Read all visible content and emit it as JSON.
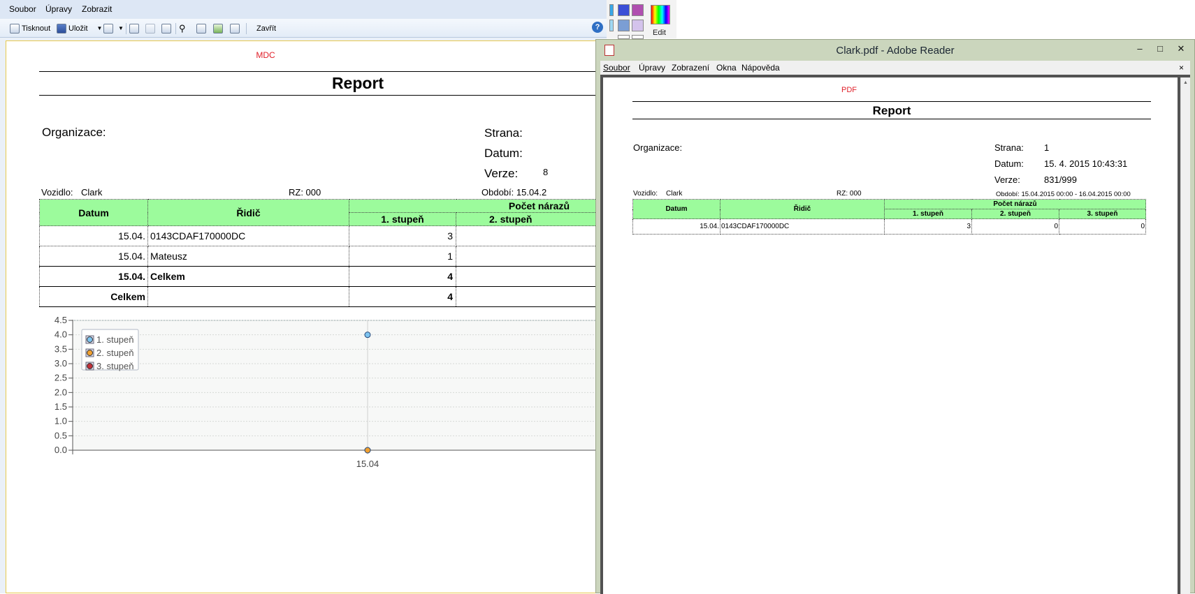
{
  "viewer": {
    "menu": [
      "Soubor",
      "Úpravy",
      "Zobrazit"
    ],
    "toolbar": {
      "print_label": "Tisknout",
      "save_label": "Uložit",
      "close_label": "Zavřít"
    },
    "help_label": "?"
  },
  "report": {
    "mdc": "MDC",
    "title": "Report",
    "organizace_label": "Organizace:",
    "strana_label": "Strana:",
    "datum_label": "Datum:",
    "verze_label": "Verze:",
    "verze_partial": "8",
    "vozidlo_label": "Vozidlo:",
    "vozidlo_value": "Clark",
    "rz": "RZ: 000",
    "obdobi": "Období: 15.04.2",
    "table": {
      "col_datum": "Datum",
      "col_ridic": "Řidič",
      "col_group": "Počet nárazů",
      "col_stupen1": "1. stupeň",
      "col_stupen2": "2. stupeň",
      "rows": [
        {
          "datum": "15.04.",
          "ridic": "0143CDAF170000DC",
          "s1": "3",
          "bold": false
        },
        {
          "datum": "15.04.",
          "ridic": "Mateusz",
          "s1": "1",
          "bold": false
        },
        {
          "datum": "15.04.",
          "ridic": "Celkem",
          "s1": "4",
          "bold": true
        },
        {
          "datum": "Celkem",
          "ridic": "",
          "s1": "4",
          "bold": true
        }
      ]
    }
  },
  "chart_data": {
    "type": "scatter",
    "x": [
      "15.04"
    ],
    "series": [
      {
        "name": "1. stupeň",
        "color": "#7ec4f0",
        "values": [
          4
        ]
      },
      {
        "name": "2. stupeň",
        "color": "#f0a030",
        "values": [
          0
        ]
      },
      {
        "name": "3. stupeň",
        "color": "#c0303a",
        "values": [
          0
        ]
      }
    ],
    "yticks": [
      "4.5",
      "4.0",
      "3.5",
      "3.0",
      "2.5",
      "2.0",
      "1.5",
      "1.0",
      "0.5",
      "0.0"
    ],
    "ylim": [
      0,
      4.5
    ],
    "grid": true,
    "legend": "top-left"
  },
  "palette": {
    "edit_label": "Edit"
  },
  "reader": {
    "title": "Clark.pdf - Adobe Reader",
    "menu": [
      "Soubor",
      "Úpravy",
      "Zobrazení",
      "Okna",
      "Nápověda"
    ],
    "close_x": "×",
    "pdf": {
      "pdf_tag": "PDF",
      "title": "Report",
      "organizace_label": "Organizace:",
      "strana_label": "Strana:",
      "strana_value": "1",
      "datum_label": "Datum:",
      "datum_value": "15. 4. 2015 10:43:31",
      "verze_label": "Verze:",
      "verze_value": "831/999",
      "vozidlo_label": "Vozidlo:",
      "vozidlo_value": "Clark",
      "rz": "RZ: 000",
      "obdobi": "Období: 15.04.2015 00:00 - 16.04.2015 00:00",
      "table": {
        "col_datum": "Datum",
        "col_ridic": "Řidič",
        "col_group": "Počet nárazů",
        "col_stupen1": "1. stupeň",
        "col_stupen2": "2. stupeň",
        "col_stupen3": "3. stupeň",
        "row": {
          "datum": "15.04.",
          "ridic": "0143CDAF170000DC",
          "s1": "3",
          "s2": "0",
          "s3": "0"
        }
      }
    }
  }
}
